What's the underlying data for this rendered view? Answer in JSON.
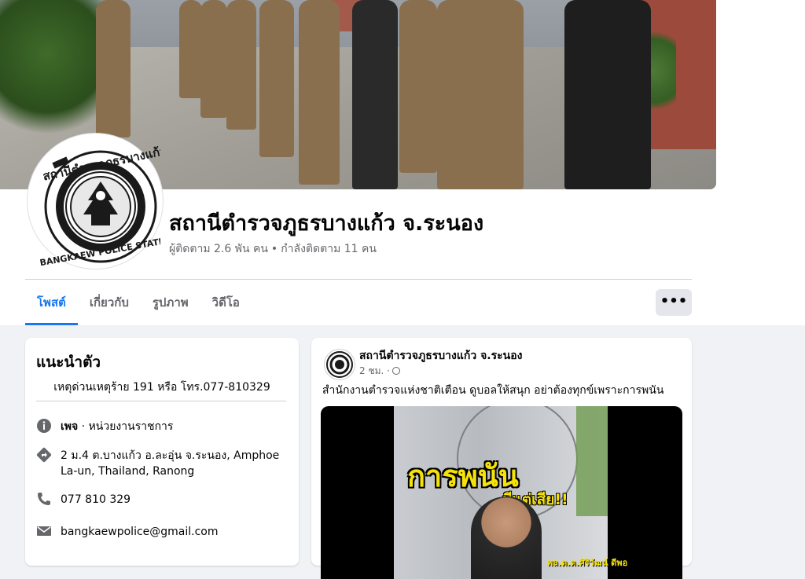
{
  "page": {
    "name": "สถานีตำรวจภูธรบางแก้ว จ.ระนอง",
    "followers": "ผู้ติดตาม 2.6 พัน คน",
    "separator": "•",
    "following": "กำลังติดตาม 11 คน",
    "logo_text_top": "สถานีตำรวจภูธรบางแก้ว",
    "logo_text_bottom": "BANGKAEW POLICE STATION"
  },
  "tabs": [
    {
      "label": "โพสต์",
      "active": true
    },
    {
      "label": "เกี่ยวกับ",
      "active": false
    },
    {
      "label": "รูปภาพ",
      "active": false
    },
    {
      "label": "วิดีโอ",
      "active": false
    }
  ],
  "more_button": {
    "label": "•••"
  },
  "intro": {
    "title": "แนะนำตัว",
    "bio": "เหตุด่วนเหตุร้าย 191 หรือ โทร.077-810329",
    "category_prefix": "เพจ",
    "category": " · หน่วยงานราชการ",
    "address": "2 ม.4 ต.บางแก้ว อ.ละอุ่น จ.ระนอง, Amphoe La-un, Thailand, Ranong",
    "phone": "077 810 329",
    "email": "bangkaewpolice@gmail.com",
    "icons": [
      "info-icon",
      "directions-icon",
      "phone-icon",
      "mail-icon"
    ]
  },
  "post": {
    "author": "สถานีตำรวจภูธรบางแก้ว จ.ระนอง",
    "time": "2 ชม. ·",
    "text": "สำนักงานตำรวจแห่งชาติเตือน ดูบอลให้สนุก อย่าต้องทุกข์เพราะการพนัน",
    "video_headline": "การพนัน",
    "video_sub": "มีแต่เสีย!!",
    "video_caption": "พล.ต.ต.ศิริวัฒน์ ดีพอ"
  },
  "colors": {
    "accent": "#1877f2",
    "background": "#f0f2f5",
    "secondary_text": "#65676b",
    "video_text": "#f5e20a"
  }
}
